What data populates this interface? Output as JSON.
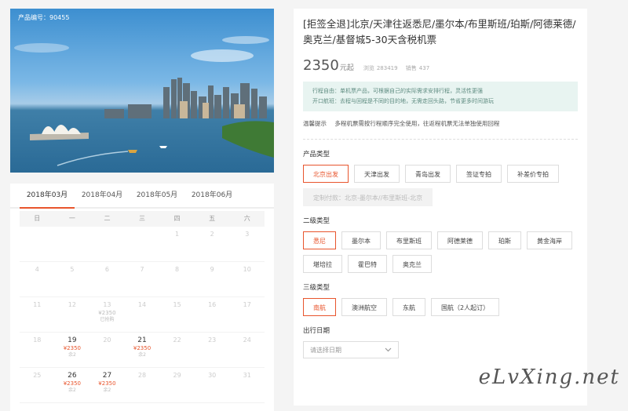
{
  "hero": {
    "product_code": "产品编号：90455"
  },
  "calendar": {
    "tabs": [
      "2018年03月",
      "2018年04月",
      "2018年05月",
      "2018年06月"
    ],
    "weekdays": [
      "日",
      "一",
      "二",
      "三",
      "四",
      "五",
      "六"
    ],
    "weeks": [
      [
        {
          "d": ""
        },
        {
          "d": ""
        },
        {
          "d": ""
        },
        {
          "d": ""
        },
        {
          "d": "1"
        },
        {
          "d": "2"
        },
        {
          "d": "3"
        }
      ],
      [
        {
          "d": "4"
        },
        {
          "d": "5"
        },
        {
          "d": "6"
        },
        {
          "d": "7"
        },
        {
          "d": "8"
        },
        {
          "d": "9"
        },
        {
          "d": "10"
        }
      ],
      [
        {
          "d": "11"
        },
        {
          "d": "12"
        },
        {
          "d": "13",
          "p": "¥2350",
          "s": "已抢购"
        },
        {
          "d": "14"
        },
        {
          "d": "15"
        },
        {
          "d": "16"
        },
        {
          "d": "17"
        }
      ],
      [
        {
          "d": "18"
        },
        {
          "d": "19",
          "on": true,
          "p": "¥2350",
          "s": "余2"
        },
        {
          "d": "20"
        },
        {
          "d": "21",
          "on": true,
          "p": "¥2350",
          "s": "余2"
        },
        {
          "d": "22"
        },
        {
          "d": "23"
        },
        {
          "d": "24"
        }
      ],
      [
        {
          "d": "25"
        },
        {
          "d": "26",
          "on": true,
          "p": "¥2350",
          "s": "余2"
        },
        {
          "d": "27",
          "on": true,
          "p": "¥2350",
          "s": "余2"
        },
        {
          "d": "28"
        },
        {
          "d": "29"
        },
        {
          "d": "30"
        },
        {
          "d": "31"
        }
      ]
    ]
  },
  "product": {
    "title": "[拒签全退]北京/天津往返悉尼/墨尔本/布里斯班/珀斯/阿德莱德/奥克兰/基督城5-30天含税机票",
    "price": "2350",
    "price_unit": "元起",
    "views_label": "浏览",
    "views": "283419",
    "sales_label": "销售",
    "sales": "437",
    "info_line1": "行程自由：单机票产品，可根据自己的实际需求安排行程，灵活性更强",
    "info_line2": "开口航班：去程与回程是不同的目的地，无需走回头路，节省更多时间游玩",
    "tip_label": "温馨提示",
    "tip_text": "多程机票需按行程顺序完全使用，往返程机票无法单独使用回程"
  },
  "sections": {
    "product_type": {
      "label": "产品类型",
      "options": [
        "北京出发",
        "天津出发",
        "青岛出发",
        "签证专拍",
        "补差价专拍",
        "定制付款：北京-墨尔本//布里斯班-北京"
      ]
    },
    "level2": {
      "label": "二级类型",
      "options": [
        "悉尼",
        "墨尔本",
        "布里斯班",
        "阿德莱德",
        "珀斯",
        "黄金海岸",
        "堪培拉",
        "霍巴特",
        "奥克兰"
      ]
    },
    "level3": {
      "label": "三级类型",
      "options": [
        "南航",
        "澳洲航空",
        "东航",
        "国航（2人起订）"
      ]
    },
    "date": {
      "label": "出行日期",
      "placeholder": "请选择日期"
    }
  },
  "watermark": "eLvXing.net",
  "colors": {
    "accent": "#e8552d",
    "info_bg": "#e8f4f1"
  }
}
